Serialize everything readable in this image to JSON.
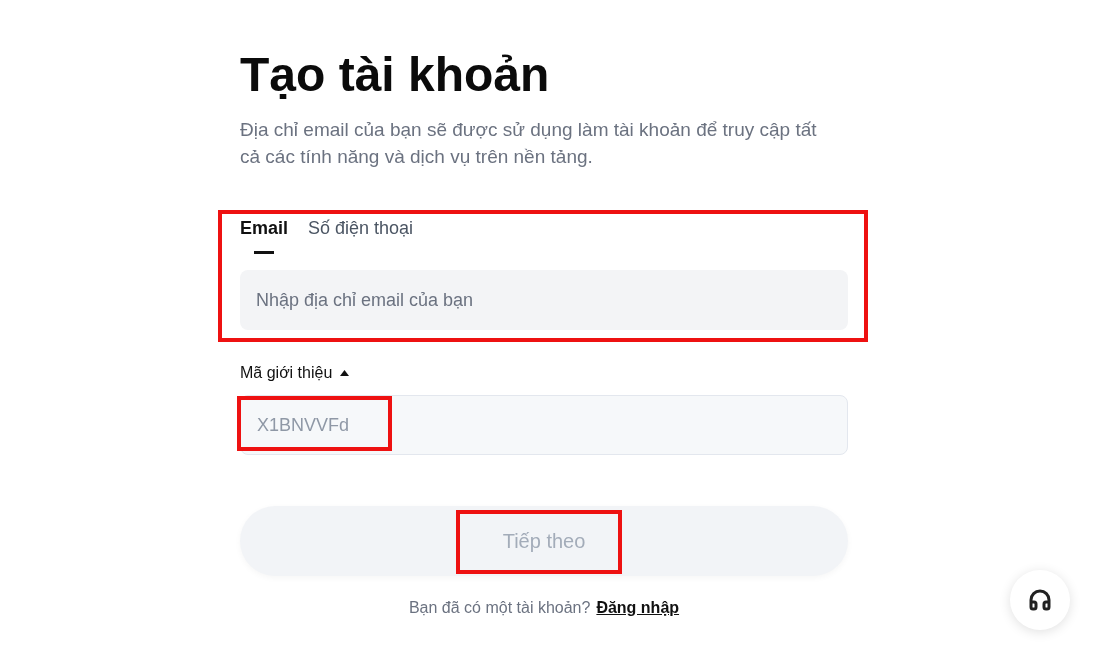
{
  "header": {
    "title": "Tạo tài khoản",
    "description": "Địa chỉ email của bạn sẽ được sử dụng làm tài khoản để truy cập tất cả các tính năng và dịch vụ trên nền tảng."
  },
  "login_method": {
    "highlighted": true,
    "tabs": [
      {
        "label": "Email",
        "selected": true
      },
      {
        "label": "Số điện thoại",
        "selected": false
      }
    ],
    "email_field": {
      "placeholder": "Nhập địa chỉ email của bạn"
    }
  },
  "referral": {
    "label": "Mã giới thiệu",
    "expanded": true,
    "field": {
      "value": "X1BNVVFd",
      "disabled": true,
      "highlighted": true
    }
  },
  "submit_button": {
    "label": "Tiếp theo",
    "disabled": true,
    "highlighted": true
  },
  "footer": {
    "prompt": "Bạn đã có một tài khoản?",
    "link": "Đăng nhập"
  }
}
